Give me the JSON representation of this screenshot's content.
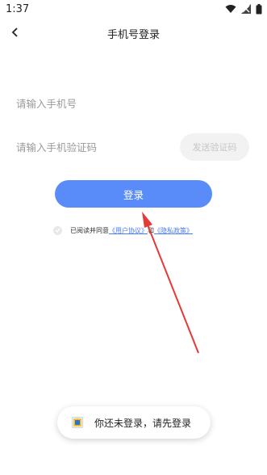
{
  "status_bar": {
    "time": "1:37"
  },
  "header": {
    "title": "手机号登录"
  },
  "form": {
    "phone_placeholder": "请输入手机号",
    "code_placeholder": "请输入手机验证码",
    "send_code_label": "发送验证码",
    "login_label": "登录"
  },
  "agreement": {
    "prefix": "已阅读并同意",
    "user_agreement": "《用户协议》",
    "conjunction": "和",
    "privacy_policy": "《隐私政策》"
  },
  "toast": {
    "message": "你还未登录，请先登录"
  },
  "colors": {
    "accent": "#5a8cf9",
    "link": "#4a7df0",
    "annotation_arrow": "#e53935"
  }
}
